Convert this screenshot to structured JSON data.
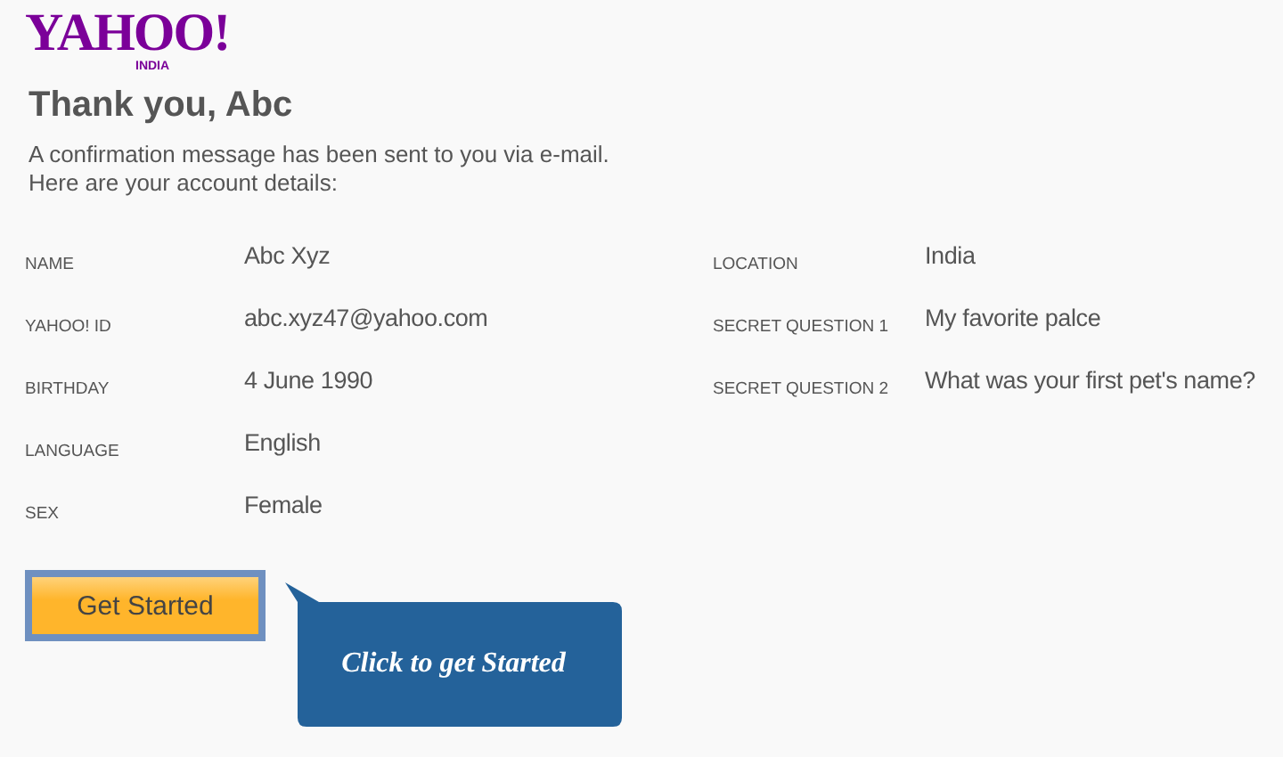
{
  "logo": {
    "brand": "YAHOO!",
    "region": "INDIA"
  },
  "heading": "Thank you, Abc",
  "message": [
    "A confirmation message has been sent to you via e-mail.",
    "Here are your account details:"
  ],
  "details_left": [
    {
      "label": "NAME",
      "value": "Abc Xyz"
    },
    {
      "label": "YAHOO! ID",
      "value": "abc.xyz47@yahoo.com"
    },
    {
      "label": "BIRTHDAY",
      "value": "4 June 1990"
    },
    {
      "label": "LANGUAGE",
      "value": "English"
    },
    {
      "label": "SEX",
      "value": "Female"
    }
  ],
  "details_right": [
    {
      "label": "LOCATION",
      "value": "India"
    },
    {
      "label": "SECRET QUESTION 1",
      "value": "My favorite palce"
    },
    {
      "label": "SECRET QUESTION 2",
      "value": "What was your first pet's name?"
    }
  ],
  "button": "Get Started",
  "callout": "Click to get Started"
}
